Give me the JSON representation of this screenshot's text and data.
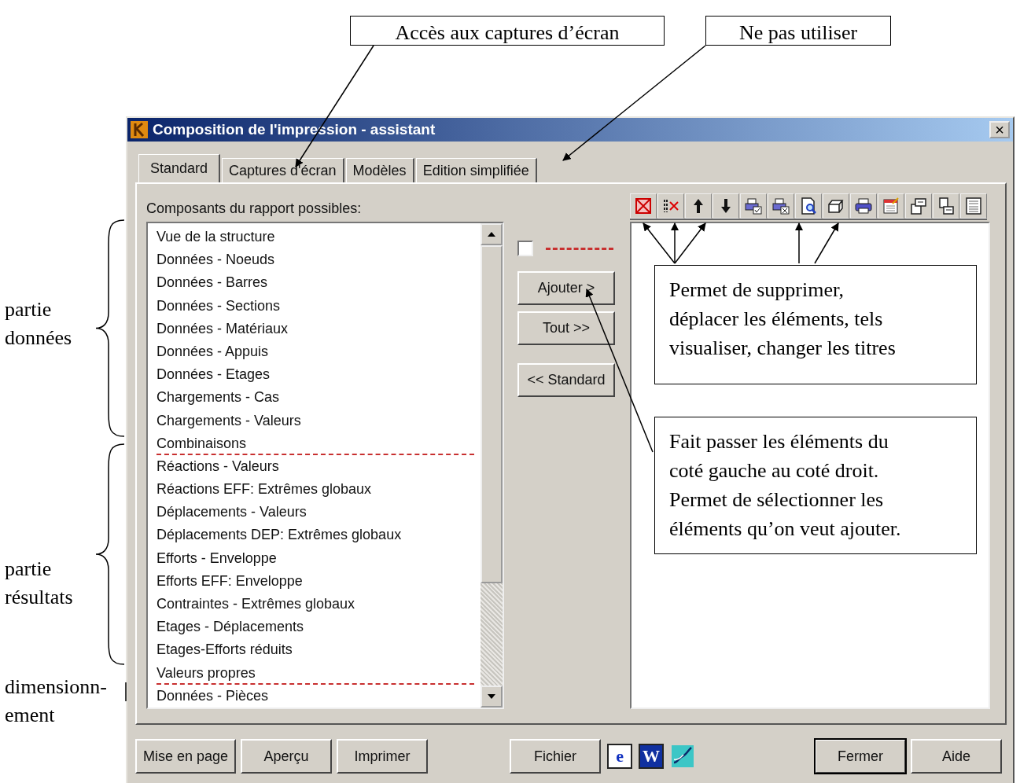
{
  "callouts_top": [
    {
      "text": "Accès aux captures d’écran"
    },
    {
      "text": "Ne pas utiliser"
    }
  ],
  "side_labels": [
    {
      "text": "partie\ndonnées"
    },
    {
      "text": "partie\nrésultats"
    },
    {
      "text": "dimensionn-\nement"
    }
  ],
  "callouts_panel": [
    {
      "text": "Permet de supprimer,\ndéplacer les éléments, tels\nvisualiser, changer les titres"
    },
    {
      "text": "Fait passer les éléments du\ncoté gauche au coté droit.\nPermet de sélectionner les\néléments qu’on veut ajouter."
    }
  ],
  "window": {
    "title": "Composition de l'impression - assistant",
    "close": "×"
  },
  "tabs": [
    {
      "label": "Standard",
      "selected": true
    },
    {
      "label": "Captures d'écran",
      "selected": false
    },
    {
      "label": "Modèles",
      "selected": false
    },
    {
      "label": "Edition simplifiée",
      "selected": false
    }
  ],
  "components_label": "Composants du rapport possibles:",
  "components": [
    {
      "label": "Vue de la structure",
      "separator_below": false
    },
    {
      "label": "Données - Noeuds",
      "separator_below": false
    },
    {
      "label": "Données - Barres",
      "separator_below": false
    },
    {
      "label": "Données - Sections",
      "separator_below": false
    },
    {
      "label": "Données - Matériaux",
      "separator_below": false
    },
    {
      "label": "Données - Appuis",
      "separator_below": false
    },
    {
      "label": "Données - Etages",
      "separator_below": false
    },
    {
      "label": "Chargements - Cas",
      "separator_below": false
    },
    {
      "label": "Chargements - Valeurs",
      "separator_below": false
    },
    {
      "label": "Combinaisons",
      "separator_below": true
    },
    {
      "label": "Réactions - Valeurs",
      "separator_below": false
    },
    {
      "label": "Réactions EFF: Extrêmes globaux",
      "separator_below": false
    },
    {
      "label": "Déplacements - Valeurs",
      "separator_below": false
    },
    {
      "label": "Déplacements DEP: Extrêmes globaux",
      "separator_below": false
    },
    {
      "label": "Efforts - Enveloppe",
      "separator_below": false
    },
    {
      "label": "Efforts EFF: Enveloppe",
      "separator_below": false
    },
    {
      "label": "Contraintes - Extrêmes globaux",
      "separator_below": false
    },
    {
      "label": "Etages - Déplacements",
      "separator_below": false
    },
    {
      "label": "Etages-Efforts réduits",
      "separator_below": false
    },
    {
      "label": "Valeurs propres",
      "separator_below": true
    },
    {
      "label": "Données - Pièces",
      "separator_below": false
    }
  ],
  "separator_checkbox": {
    "checked": false
  },
  "move_buttons": [
    {
      "label": "Ajouter >"
    },
    {
      "label": "Tout >>"
    },
    {
      "label": "<< Standard"
    }
  ],
  "bottom_left_buttons": [
    {
      "label": "Mise en page"
    },
    {
      "label": "Aperçu"
    },
    {
      "label": "Imprimer"
    }
  ],
  "bottom_middle_buttons": [
    {
      "label": "Fichier"
    }
  ],
  "bottom_right_buttons": [
    {
      "label": "Fermer",
      "default": true
    },
    {
      "label": "Aide",
      "default": false
    }
  ],
  "export_icons": [
    {
      "kind": "browser",
      "glyph": "e"
    },
    {
      "kind": "word",
      "glyph": "W"
    },
    {
      "kind": "chart"
    }
  ]
}
